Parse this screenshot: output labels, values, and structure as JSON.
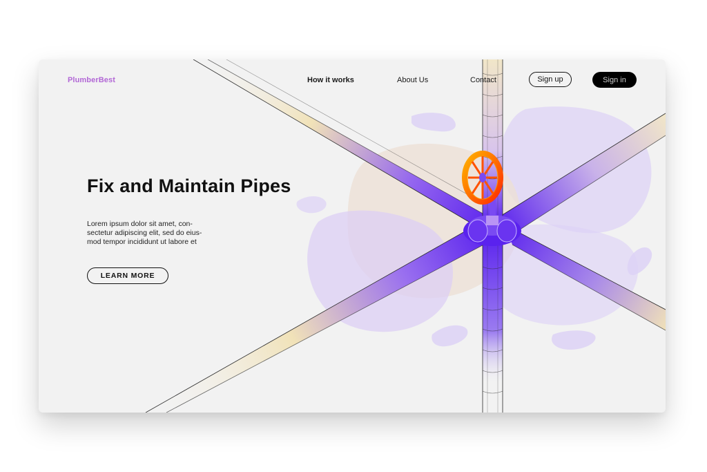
{
  "brand": {
    "name": "PlumberBest",
    "color": "#b267d6"
  },
  "nav": {
    "items": [
      {
        "label": "How it works",
        "active": true
      },
      {
        "label": "About Us",
        "active": false
      },
      {
        "label": "Contact",
        "active": false
      }
    ],
    "signup_label": "Sign up",
    "signin_label": "Sign in"
  },
  "hero": {
    "title": "Fix and Maintain Pipes",
    "text_lines": [
      "Lorem ipsum dolor sit amet, con-",
      "sectetur adipiscing elit, sed do eius-",
      "mod tempor incididunt ut labore et"
    ],
    "cta_label": "LEARN MORE"
  },
  "illustration": {
    "name": "pipe-junction-illustration",
    "valve_icon": "valve-wheel-icon",
    "colors": {
      "pipe_purple": "#6a2cf0",
      "pipe_cream": "#f1e2b8",
      "valve_orange": "#ff6a00",
      "blob_lavender": "#d8ccf4"
    }
  },
  "colors": {
    "background": "#f2f2f2",
    "text": "#111111",
    "accent": "#b267d6"
  }
}
